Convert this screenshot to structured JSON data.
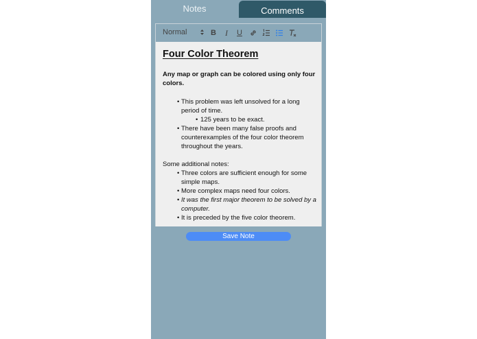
{
  "tabs": {
    "notes_label": "Notes",
    "comments_label": "Comments"
  },
  "toolbar": {
    "format_value": "Normal",
    "bold_label": "B",
    "italic_label": "I",
    "underline_label": "U"
  },
  "note": {
    "title": "Four Color Theorem",
    "intro": "Any map or graph can be colored using only four colors.",
    "list1": [
      "This problem was left unsolved for a long period of time.",
      "125 years to be exact.",
      "There have been many false proofs and counterexamples of the four color theorem throughout the years."
    ],
    "additional_heading": "Some additional notes:",
    "list2": [
      "Three colors are sufficient enough for some simple maps.",
      "More complex maps need four colors.",
      "It was the first major theorem to be solved by a computer.",
      "It is preceded by the five color theorem."
    ]
  },
  "actions": {
    "save_label": "Save Note"
  },
  "colors": {
    "panel_bg": "#8aa8b8",
    "active_tab": "#2f5968",
    "save_button": "#4d8cf6",
    "editor_bg": "#efefef",
    "list_icon_active": "#2f7fe8"
  }
}
